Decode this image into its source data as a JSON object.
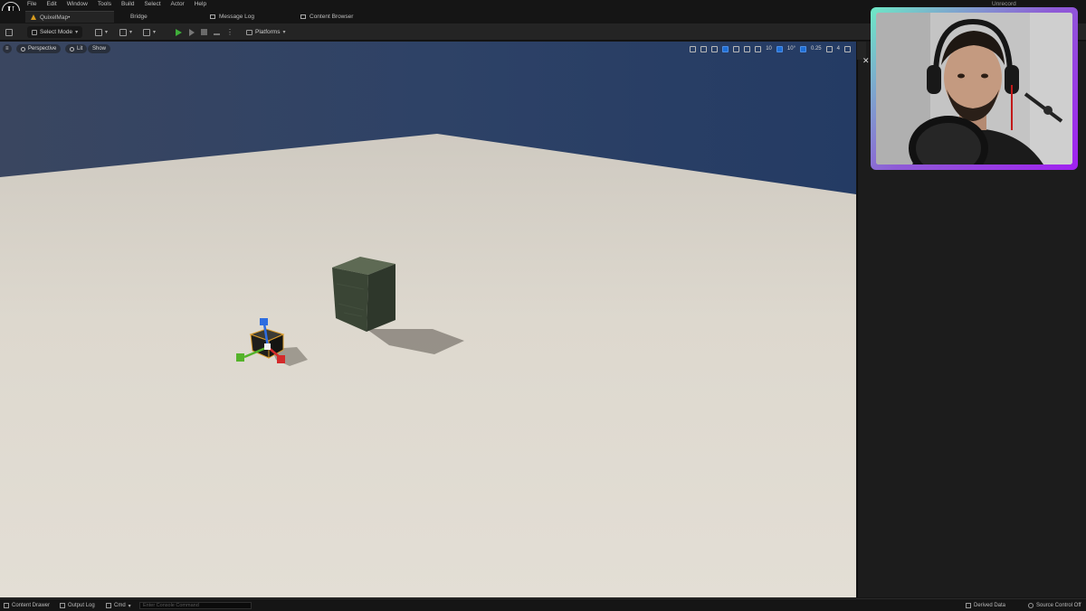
{
  "menu": {
    "logo": "U",
    "items": [
      "File",
      "Edit",
      "Window",
      "Tools",
      "Build",
      "Select",
      "Actor",
      "Help"
    ],
    "right_label": "Unrecord"
  },
  "tabs": [
    {
      "label": "QuixelMap•",
      "active": true,
      "icon": "map-icon"
    },
    {
      "label": "Bridge",
      "active": false,
      "icon": ""
    },
    {
      "label": "Message Log",
      "active": false,
      "icon": "message-log-icon"
    },
    {
      "label": "Content Browser",
      "active": false,
      "icon": "content-browser-icon"
    }
  ],
  "toolbar": {
    "save_icon": "save-icon",
    "mode_label": "Select Mode",
    "platforms_label": "Platforms",
    "play_color": "#3fae3a"
  },
  "viewport": {
    "perspective_label": "Perspective",
    "lit_label": "Lit",
    "show_label": "Show",
    "grid_snap": "10",
    "rotate_snap": "10°",
    "scale_snap": "0.25",
    "camera_speed": "4",
    "sky_color": "#2b3e62",
    "floor_color": "#e2ddd3"
  },
  "statusbar": {
    "content_drawer": "Content Drawer",
    "output_log": "Output Log",
    "cmd": "Cmd",
    "console_placeholder": "Enter Console Command",
    "derived_data": "Derived Data",
    "source_control": "Source Control Off"
  },
  "webcam": {
    "border_color_start": "#6ee9c6",
    "border_color_end": "#a020f0"
  }
}
